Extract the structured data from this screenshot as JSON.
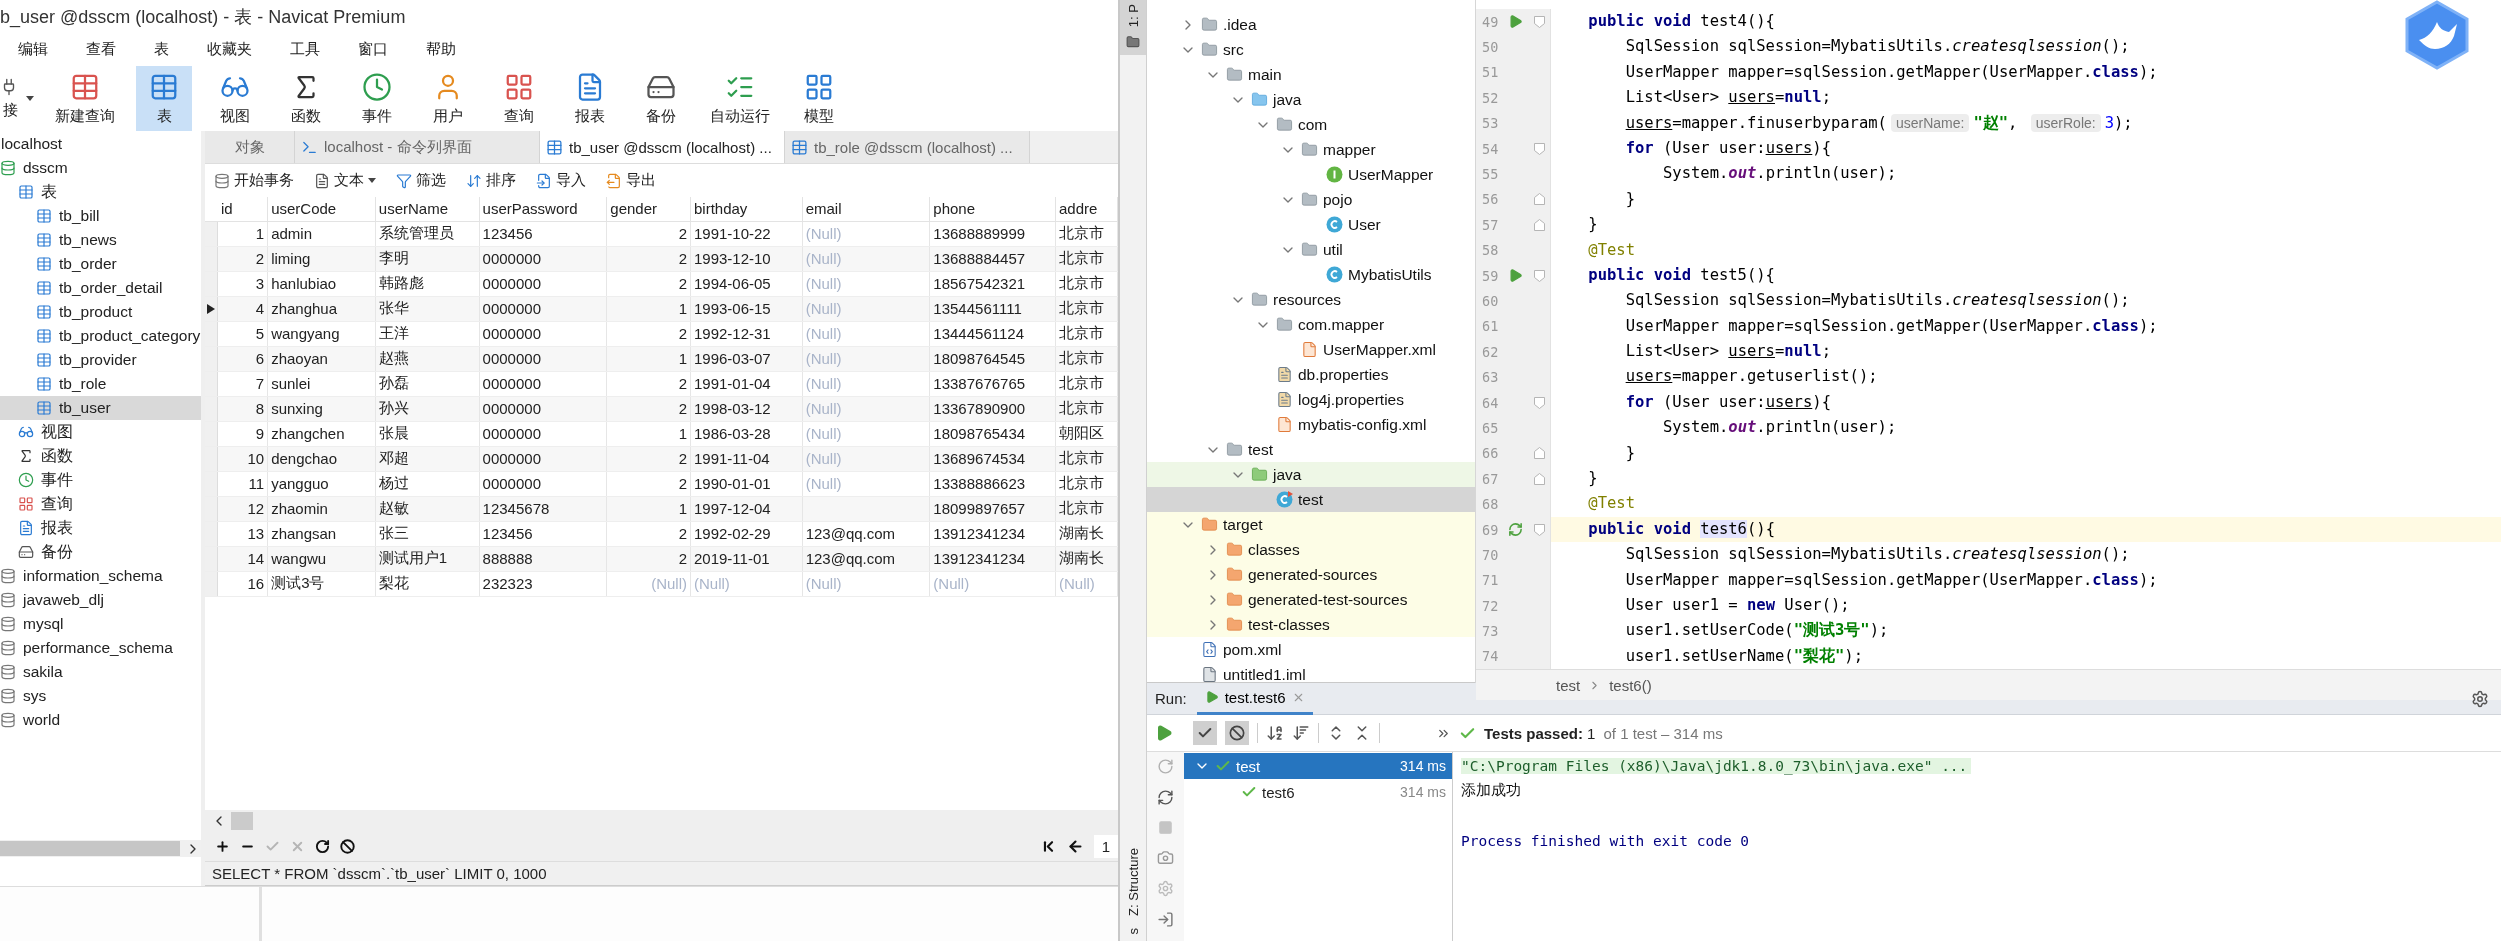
{
  "navicat": {
    "title": "b_user @dsscm (localhost) - 表 - Navicat Premium",
    "menu": [
      "编辑",
      "查看",
      "表",
      "收藏夹",
      "工具",
      "窗口",
      "帮助"
    ],
    "toolbar": [
      {
        "label": "接",
        "kind": "connect",
        "selected": false,
        "dropdown": true
      },
      {
        "label": "新建查询",
        "kind": "new-query",
        "selected": false,
        "dropdown": false
      },
      {
        "label": "表",
        "kind": "table",
        "selected": true,
        "dropdown": false
      },
      {
        "label": "视图",
        "kind": "view",
        "selected": false,
        "dropdown": false
      },
      {
        "label": "函数",
        "kind": "function",
        "selected": false,
        "dropdown": false
      },
      {
        "label": "事件",
        "kind": "event",
        "selected": false,
        "dropdown": false
      },
      {
        "label": "用户",
        "kind": "user",
        "selected": false,
        "dropdown": false
      },
      {
        "label": "查询",
        "kind": "query",
        "selected": false,
        "dropdown": false
      },
      {
        "label": "报表",
        "kind": "report",
        "selected": false,
        "dropdown": false
      },
      {
        "label": "备份",
        "kind": "backup",
        "selected": false,
        "dropdown": false
      },
      {
        "label": "自动运行",
        "kind": "automation",
        "selected": false,
        "dropdown": false
      },
      {
        "label": "模型",
        "kind": "model",
        "selected": false,
        "dropdown": false
      }
    ],
    "sidebar": [
      {
        "label": "localhost",
        "selected": false,
        "children": [
          {
            "label": "dsscm",
            "kind": "db-open",
            "selected": false,
            "children": [
              {
                "label": "表",
                "kind": "tables",
                "selected": false,
                "children": [
                  {
                    "label": "tb_bill",
                    "kind": "table",
                    "selected": false
                  },
                  {
                    "label": "tb_news",
                    "kind": "table",
                    "selected": false
                  },
                  {
                    "label": "tb_order",
                    "kind": "table",
                    "selected": false
                  },
                  {
                    "label": "tb_order_detail",
                    "kind": "table",
                    "selected": false
                  },
                  {
                    "label": "tb_product",
                    "kind": "table",
                    "selected": false
                  },
                  {
                    "label": "tb_product_category",
                    "kind": "table",
                    "selected": false
                  },
                  {
                    "label": "tb_provider",
                    "kind": "table",
                    "selected": false
                  },
                  {
                    "label": "tb_role",
                    "kind": "table",
                    "selected": false
                  },
                  {
                    "label": "tb_user",
                    "kind": "table",
                    "selected": true
                  }
                ]
              },
              {
                "label": "视图",
                "kind": "view",
                "selected": false
              },
              {
                "label": "函数",
                "kind": "function",
                "selected": false
              },
              {
                "label": "事件",
                "kind": "event",
                "selected": false
              },
              {
                "label": "查询",
                "kind": "query",
                "selected": false
              },
              {
                "label": "报表",
                "kind": "report",
                "selected": false
              },
              {
                "label": "备份",
                "kind": "backup",
                "selected": false
              }
            ]
          },
          {
            "label": "information_schema",
            "kind": "db",
            "selected": false
          },
          {
            "label": "javaweb_dlj",
            "kind": "db",
            "selected": false
          },
          {
            "label": "mysql",
            "kind": "db",
            "selected": false
          },
          {
            "label": "performance_schema",
            "kind": "db",
            "selected": false
          },
          {
            "label": "sakila",
            "kind": "db",
            "selected": false
          },
          {
            "label": "sys",
            "kind": "db",
            "selected": false
          },
          {
            "label": "world",
            "kind": "db",
            "selected": false
          }
        ]
      }
    ],
    "tabs": [
      {
        "label": "对象",
        "kind": "plain",
        "selected": false
      },
      {
        "label": "localhost - 命令列界面",
        "kind": "terminal",
        "selected": false
      },
      {
        "label": "tb_user @dsscm (localhost) ...",
        "kind": "table",
        "selected": true
      },
      {
        "label": "tb_role @dsscm (localhost) ...",
        "kind": "table",
        "selected": false
      }
    ],
    "actions": [
      {
        "label": "开始事务",
        "kind": "transaction",
        "dropdown": false
      },
      {
        "label": "文本",
        "kind": "text",
        "dropdown": true
      },
      {
        "label": "筛选",
        "kind": "filter",
        "dropdown": false
      },
      {
        "label": "排序",
        "kind": "sort",
        "dropdown": false
      },
      {
        "label": "导入",
        "kind": "import",
        "dropdown": false
      },
      {
        "label": "导出",
        "kind": "export",
        "dropdown": false
      }
    ],
    "table": {
      "columns": [
        "id",
        "userCode",
        "userName",
        "userPassword",
        "gender",
        "birthday",
        "email",
        "phone",
        "addre"
      ],
      "rows": [
        {
          "current": false,
          "cells": [
            "1",
            "admin",
            "系统管理员",
            "123456",
            "2",
            "1991-10-22",
            {
              "text": "(Null)",
              "null": true
            },
            "13688889999",
            "北京市"
          ]
        },
        {
          "current": false,
          "cells": [
            "2",
            "liming",
            "李明",
            "0000000",
            "2",
            "1993-12-10",
            {
              "text": "(Null)",
              "null": true
            },
            "13688884457",
            "北京市"
          ]
        },
        {
          "current": false,
          "cells": [
            "3",
            "hanlubiao",
            "韩路彪",
            "0000000",
            "2",
            "1994-06-05",
            {
              "text": "(Null)",
              "null": true
            },
            "18567542321",
            "北京市"
          ]
        },
        {
          "current": true,
          "cells": [
            "4",
            "zhanghua",
            "张华",
            "0000000",
            "1",
            "1993-06-15",
            {
              "text": "(Null)",
              "null": true
            },
            "13544561111",
            "北京市"
          ]
        },
        {
          "current": false,
          "cells": [
            "5",
            "wangyang",
            "王洋",
            "0000000",
            "2",
            "1992-12-31",
            {
              "text": "(Null)",
              "null": true
            },
            "13444561124",
            "北京市"
          ]
        },
        {
          "current": false,
          "cells": [
            "6",
            "zhaoyan",
            "赵燕",
            "0000000",
            "1",
            "1996-03-07",
            {
              "text": "(Null)",
              "null": true
            },
            "18098764545",
            "北京市"
          ]
        },
        {
          "current": false,
          "cells": [
            "7",
            "sunlei",
            "孙磊",
            "0000000",
            "2",
            "1991-01-04",
            {
              "text": "(Null)",
              "null": true
            },
            "13387676765",
            "北京市"
          ]
        },
        {
          "current": false,
          "cells": [
            "8",
            "sunxing",
            "孙兴",
            "0000000",
            "2",
            "1998-03-12",
            {
              "text": "(Null)",
              "null": true
            },
            "13367890900",
            "北京市"
          ]
        },
        {
          "current": false,
          "cells": [
            "9",
            "zhangchen",
            "张晨",
            "0000000",
            "1",
            "1986-03-28",
            {
              "text": "(Null)",
              "null": true
            },
            "18098765434",
            "朝阳区"
          ]
        },
        {
          "current": false,
          "cells": [
            "10",
            "dengchao",
            "邓超",
            "0000000",
            "2",
            "1991-11-04",
            {
              "text": "(Null)",
              "null": true
            },
            "13689674534",
            "北京市"
          ]
        },
        {
          "current": false,
          "cells": [
            "11",
            "yangguo",
            "杨过",
            "0000000",
            "2",
            "1990-01-01",
            {
              "text": "(Null)",
              "null": true
            },
            "13388886623",
            "北京市"
          ]
        },
        {
          "current": false,
          "cells": [
            "12",
            "zhaomin",
            "赵敏",
            "12345678",
            "1",
            "1997-12-04",
            null,
            "18099897657",
            "北京市"
          ]
        },
        {
          "current": false,
          "cells": [
            "13",
            "zhangsan",
            "张三",
            "123456",
            "2",
            "1992-02-29",
            "123@qq.com",
            "13912341234",
            "湖南长"
          ]
        },
        {
          "current": false,
          "cells": [
            "14",
            "wangwu",
            "测试用户1",
            "888888",
            "2",
            "2019-11-01",
            "123@qq.com",
            "13912341234",
            "湖南长"
          ]
        },
        {
          "current": false,
          "cells": [
            "16",
            "测试3号",
            "梨花",
            "232323",
            {
              "text": "(Null)",
              "null": true
            },
            {
              "text": "(Null)",
              "null": true
            },
            {
              "text": "(Null)",
              "null": true
            },
            {
              "text": "(Null)",
              "null": true
            },
            {
              "text": "(Null)",
              "null": true
            }
          ]
        }
      ]
    },
    "record_buttons": [
      {
        "kind": "add",
        "disabled": false
      },
      {
        "kind": "delete",
        "disabled": false
      },
      {
        "kind": "apply",
        "disabled": true
      },
      {
        "kind": "discard",
        "disabled": true
      },
      {
        "kind": "refresh",
        "disabled": false
      },
      {
        "kind": "stop",
        "disabled": false
      }
    ],
    "page": "1",
    "sql": "SELECT * FROM `dsscm`.`tb_user` LIMIT 0, 1000"
  },
  "ide": {
    "side_tabs": [
      {
        "label": "1: P",
        "selected": true
      },
      {
        "label": "Z: Structure",
        "selected": false
      },
      {
        "label": "s",
        "selected": false
      }
    ],
    "tree": [
      {
        "label": ".idea",
        "kind": "folder",
        "expanded": false,
        "selected": false,
        "excluded": false
      },
      {
        "label": "src",
        "kind": "folder",
        "expanded": true,
        "selected": false,
        "excluded": false,
        "children": [
          {
            "label": "main",
            "kind": "folder",
            "expanded": true,
            "selected": false,
            "excluded": false,
            "children": [
              {
                "label": "java",
                "kind": "source-folder",
                "expanded": true,
                "selected": false,
                "excluded": false,
                "children": [
                  {
                    "label": "com",
                    "kind": "package",
                    "expanded": true,
                    "selected": false,
                    "excluded": false,
                    "children": [
                      {
                        "label": "mapper",
                        "kind": "package",
                        "expanded": true,
                        "selected": false,
                        "excluded": false,
                        "children": [
                          {
                            "label": "UserMapper",
                            "kind": "interface",
                            "selected": false,
                            "excluded": false
                          }
                        ]
                      },
                      {
                        "label": "pojo",
                        "kind": "package",
                        "expanded": true,
                        "selected": false,
                        "excluded": false,
                        "children": [
                          {
                            "label": "User",
                            "kind": "class",
                            "selected": false,
                            "excluded": false
                          }
                        ]
                      },
                      {
                        "label": "util",
                        "kind": "package",
                        "expanded": true,
                        "selected": false,
                        "excluded": false,
                        "children": [
                          {
                            "label": "MybatisUtils",
                            "kind": "class",
                            "selected": false,
                            "excluded": false
                          }
                        ]
                      }
                    ]
                  }
                ]
              },
              {
                "label": "resources",
                "kind": "resources-folder",
                "expanded": true,
                "selected": false,
                "excluded": false,
                "children": [
                  {
                    "label": "com.mapper",
                    "kind": "package",
                    "expanded": true,
                    "selected": false,
                    "excluded": false,
                    "children": [
                      {
                        "label": "UserMapper.xml",
                        "kind": "xml",
                        "selected": false,
                        "excluded": false
                      }
                    ]
                  },
                  {
                    "label": "db.properties",
                    "kind": "properties",
                    "selected": false,
                    "excluded": false
                  },
                  {
                    "label": "log4j.properties",
                    "kind": "properties",
                    "selected": false,
                    "excluded": false
                  },
                  {
                    "label": "mybatis-config.xml",
                    "kind": "xml",
                    "selected": false,
                    "excluded": false
                  }
                ]
              }
            ]
          },
          {
            "label": "test",
            "kind": "folder",
            "expanded": true,
            "selected": false,
            "excluded": false,
            "children": [
              {
                "label": "java",
                "kind": "test-source-folder",
                "expanded": true,
                "selected": false,
                "excluded": false,
                "children": [
                  {
                    "label": "test",
                    "kind": "test-class",
                    "selected": true,
                    "excluded": false
                  }
                ]
              }
            ]
          }
        ]
      },
      {
        "label": "target",
        "kind": "excluded-folder",
        "expanded": true,
        "selected": false,
        "excluded": true,
        "children": [
          {
            "label": "classes",
            "kind": "excluded-folder",
            "expanded": false,
            "selected": false,
            "excluded": true
          },
          {
            "label": "generated-sources",
            "kind": "excluded-folder",
            "expanded": false,
            "selected": false,
            "excluded": true
          },
          {
            "label": "generated-test-sources",
            "kind": "excluded-folder",
            "expanded": false,
            "selected": false,
            "excluded": true
          },
          {
            "label": "test-classes",
            "kind": "excluded-folder",
            "expanded": false,
            "selected": false,
            "excluded": true
          }
        ]
      },
      {
        "label": "pom.xml",
        "kind": "maven",
        "selected": false,
        "excluded": false
      },
      {
        "label": "untitled1.iml",
        "kind": "module",
        "selected": false,
        "excluded": false
      }
    ],
    "code": [
      {
        "no": "49",
        "kind": "run-start",
        "current": false,
        "tokens": [
          {
            "kind": "keyword",
            "text": "public void "
          },
          {
            "kind": "plain",
            "text": "test4(){"
          }
        ],
        "children": [
          {
            "no": "50",
            "kind": "plain",
            "current": false,
            "tokens": [
              {
                "kind": "plain",
                "text": "SqlSession sqlSession=MybatisUtils."
              },
              {
                "kind": "italic",
                "text": "createsqlsession"
              },
              {
                "kind": "plain",
                "text": "();"
              }
            ]
          },
          {
            "no": "51",
            "kind": "plain",
            "current": false,
            "tokens": [
              {
                "kind": "plain",
                "text": "UserMapper mapper=sqlSession.getMapper(UserMapper."
              },
              {
                "kind": "keyword",
                "text": "class"
              },
              {
                "kind": "plain",
                "text": ");"
              }
            ]
          },
          {
            "no": "52",
            "kind": "plain",
            "current": false,
            "tokens": [
              {
                "kind": "plain",
                "text": "List<User> "
              },
              {
                "kind": "variable",
                "text": "users"
              },
              {
                "kind": "plain",
                "text": "="
              },
              {
                "kind": "keyword",
                "text": "null"
              },
              {
                "kind": "plain",
                "text": ";"
              }
            ]
          },
          {
            "no": "53",
            "kind": "plain",
            "current": false,
            "tokens": [
              {
                "kind": "variable",
                "text": "users"
              },
              {
                "kind": "plain",
                "text": "=mapper.finuserbyparam("
              },
              {
                "kind": "hint",
                "text": "userName:"
              },
              {
                "kind": "string",
                "text": "\"赵\""
              },
              {
                "kind": "plain",
                "text": ", "
              },
              {
                "kind": "hint",
                "text": "userRole:"
              },
              {
                "kind": "number",
                "text": "3"
              },
              {
                "kind": "plain",
                "text": ");"
              }
            ]
          },
          {
            "no": "54",
            "kind": "block-start",
            "current": false,
            "tokens": [
              {
                "kind": "keyword",
                "text": "for"
              },
              {
                "kind": "plain",
                "text": " (User user:"
              },
              {
                "kind": "variable",
                "text": "users"
              },
              {
                "kind": "plain",
                "text": "){"
              }
            ],
            "children": [
              {
                "no": "55",
                "kind": "plain",
                "current": false,
                "tokens": [
                  {
                    "kind": "plain",
                    "text": "System."
                  },
                  {
                    "kind": "field",
                    "text": "out"
                  },
                  {
                    "kind": "plain",
                    "text": ".println(user);"
                  }
                ]
              }
            ]
          },
          {
            "no": "56",
            "kind": "block-end",
            "current": false,
            "tokens": [
              {
                "kind": "plain",
                "text": "}"
              }
            ]
          }
        ]
      },
      {
        "no": "57",
        "kind": "block-end",
        "current": false,
        "tokens": [
          {
            "kind": "plain",
            "text": "}"
          }
        ]
      },
      {
        "no": "58",
        "kind": "plain",
        "current": false,
        "tokens": [
          {
            "kind": "annotation",
            "text": "@Test"
          }
        ]
      },
      {
        "no": "59",
        "kind": "run-start",
        "current": false,
        "tokens": [
          {
            "kind": "keyword",
            "text": "public void "
          },
          {
            "kind": "plain",
            "text": "test5(){"
          }
        ],
        "children": [
          {
            "no": "60",
            "kind": "plain",
            "current": false,
            "tokens": [
              {
                "kind": "plain",
                "text": "SqlSession sqlSession=MybatisUtils."
              },
              {
                "kind": "italic",
                "text": "createsqlsession"
              },
              {
                "kind": "plain",
                "text": "();"
              }
            ]
          },
          {
            "no": "61",
            "kind": "plain",
            "current": false,
            "tokens": [
              {
                "kind": "plain",
                "text": "UserMapper mapper=sqlSession.getMapper(UserMapper."
              },
              {
                "kind": "keyword",
                "text": "class"
              },
              {
                "kind": "plain",
                "text": ");"
              }
            ]
          },
          {
            "no": "62",
            "kind": "plain",
            "current": false,
            "tokens": [
              {
                "kind": "plain",
                "text": "List<User> "
              },
              {
                "kind": "variable",
                "text": "users"
              },
              {
                "kind": "plain",
                "text": "="
              },
              {
                "kind": "keyword",
                "text": "null"
              },
              {
                "kind": "plain",
                "text": ";"
              }
            ]
          },
          {
            "no": "63",
            "kind": "plain",
            "current": false,
            "tokens": [
              {
                "kind": "variable",
                "text": "users"
              },
              {
                "kind": "plain",
                "text": "=mapper.getuserlist();"
              }
            ]
          },
          {
            "no": "64",
            "kind": "block-start",
            "current": false,
            "tokens": [
              {
                "kind": "keyword",
                "text": "for"
              },
              {
                "kind": "plain",
                "text": " (User user:"
              },
              {
                "kind": "variable",
                "text": "users"
              },
              {
                "kind": "plain",
                "text": "){"
              }
            ],
            "children": [
              {
                "no": "65",
                "kind": "plain",
                "current": false,
                "tokens": [
                  {
                    "kind": "plain",
                    "text": "System."
                  },
                  {
                    "kind": "field",
                    "text": "out"
                  },
                  {
                    "kind": "plain",
                    "text": ".println(user);"
                  }
                ]
              }
            ]
          },
          {
            "no": "66",
            "kind": "block-end",
            "current": false,
            "tokens": [
              {
                "kind": "plain",
                "text": "}"
              }
            ]
          }
        ]
      },
      {
        "no": "67",
        "kind": "block-end",
        "current": false,
        "tokens": [
          {
            "kind": "plain",
            "text": "}"
          }
        ]
      },
      {
        "no": "68",
        "kind": "plain",
        "current": false,
        "tokens": [
          {
            "kind": "annotation",
            "text": "@Test"
          }
        ]
      },
      {
        "no": "69",
        "kind": "rerun-start",
        "current": true,
        "tokens": [
          {
            "kind": "keyword",
            "text": "public void "
          },
          {
            "kind": "highlight",
            "text": "test6"
          },
          {
            "kind": "plain",
            "text": "(){"
          }
        ],
        "children": [
          {
            "no": "70",
            "kind": "plain",
            "current": false,
            "tokens": [
              {
                "kind": "plain",
                "text": "SqlSession sqlSession=MybatisUtils."
              },
              {
                "kind": "italic",
                "text": "createsqlsession"
              },
              {
                "kind": "plain",
                "text": "();"
              }
            ]
          },
          {
            "no": "71",
            "kind": "plain",
            "current": false,
            "tokens": [
              {
                "kind": "plain",
                "text": "UserMapper mapper=sqlSession.getMapper(UserMapper."
              },
              {
                "kind": "keyword",
                "text": "class"
              },
              {
                "kind": "plain",
                "text": ");"
              }
            ]
          },
          {
            "no": "72",
            "kind": "plain",
            "current": false,
            "tokens": [
              {
                "kind": "plain",
                "text": "User user1 = "
              },
              {
                "kind": "keyword",
                "text": "new"
              },
              {
                "kind": "plain",
                "text": " User();"
              }
            ]
          },
          {
            "no": "73",
            "kind": "plain",
            "current": false,
            "tokens": [
              {
                "kind": "plain",
                "text": "user1.setUserCode("
              },
              {
                "kind": "string",
                "text": "\"测试3号\""
              },
              {
                "kind": "plain",
                "text": ");"
              }
            ]
          },
          {
            "no": "74",
            "kind": "plain",
            "current": false,
            "tokens": [
              {
                "kind": "plain",
                "text": "user1.setUserName("
              },
              {
                "kind": "string",
                "text": "\"梨花\""
              },
              {
                "kind": "plain",
                "text": ");"
              }
            ]
          }
        ]
      }
    ],
    "breadcrumb": [
      "test",
      "test6()"
    ],
    "run": {
      "label": "Run:",
      "tab": "test.test6",
      "toggles": [
        {
          "kind": "passed",
          "on": true
        },
        {
          "kind": "ignored",
          "on": true
        }
      ],
      "status": "**Tests passed:** 1",
      "status_detail": "of 1 test – 314 ms",
      "tests": [
        {
          "name": "test",
          "time": "314 ms",
          "passed": true,
          "selected": true,
          "expanded": true,
          "children": [
            {
              "name": "test6",
              "time": "314 ms",
              "passed": true,
              "selected": false
            }
          ]
        }
      ],
      "console": [
        {
          "kind": "command",
          "text": "\"C:\\Program Files (x86)\\Java\\jdk1.8.0_73\\bin\\java.exe\" ..."
        },
        {
          "kind": "output",
          "text": "添加成功"
        },
        {
          "kind": "blank"
        },
        {
          "kind": "exit",
          "text": "Process finished with exit code 0"
        }
      ]
    }
  }
}
